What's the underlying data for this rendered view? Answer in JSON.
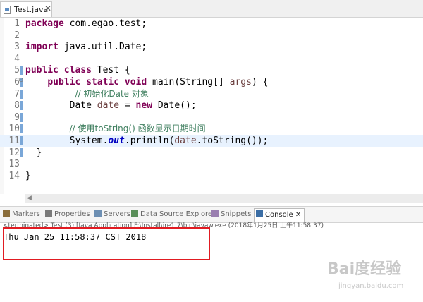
{
  "editor_tab": {
    "label": "Test.java",
    "close": "✕"
  },
  "code_lines": [
    {
      "num": "1",
      "html": "<span class=\"kw\">package</span> com.egao.test;"
    },
    {
      "num": "2",
      "html": ""
    },
    {
      "num": "3",
      "html": "<span class=\"kw\">import</span> java.util.Date;"
    },
    {
      "num": "4",
      "html": ""
    },
    {
      "num": "5",
      "html": "<span class=\"kw\">public</span> <span class=\"kw\">class</span> Test {"
    },
    {
      "num": "6",
      "html": "    <span class=\"kw\">public</span> <span class=\"kw\">static</span> <span class=\"kw\">void</span> main(String[] <span class=\"pm\">args</span>) {"
    },
    {
      "num": "7",
      "html": "         <span class=\"cm\">// 初始化Date 对象</span>"
    },
    {
      "num": "8",
      "html": "        Date <span class=\"pm\">date</span> = <span class=\"kw\">new</span> Date();"
    },
    {
      "num": "9",
      "html": ""
    },
    {
      "num": "10",
      "html": "        <span class=\"cm\">// 使用toString() 函数显示日期时间</span>"
    },
    {
      "num": "11",
      "html": "        System.<span class=\"st\">out</span>.println(<span class=\"pm\">date</span>.toString());"
    },
    {
      "num": "12",
      "html": "  }"
    },
    {
      "num": "13",
      "html": ""
    },
    {
      "num": "14",
      "html": "}"
    }
  ],
  "views": {
    "tabs": [
      {
        "label": "Markers",
        "color": "#8a6d3b"
      },
      {
        "label": "Properties",
        "color": "#7a7a7a"
      },
      {
        "label": "Servers",
        "color": "#6d8fb3"
      },
      {
        "label": "Data Source Explorer",
        "color": "#5a8f5a"
      },
      {
        "label": "Snippets",
        "color": "#9a7fb0"
      }
    ],
    "active_tab": {
      "label": "Console",
      "close": "✕"
    }
  },
  "console": {
    "description": "<terminated> Test (3) [Java Application] F:\\Install\\jre1.7\\bin\\javaw.exe (2018年1月25日 上午11:58:37)",
    "output": "Thu Jan 25 11:58:37 CST 2018"
  },
  "watermark": {
    "brand": "Bai度经验",
    "url": "jingyan.baidu.com"
  }
}
